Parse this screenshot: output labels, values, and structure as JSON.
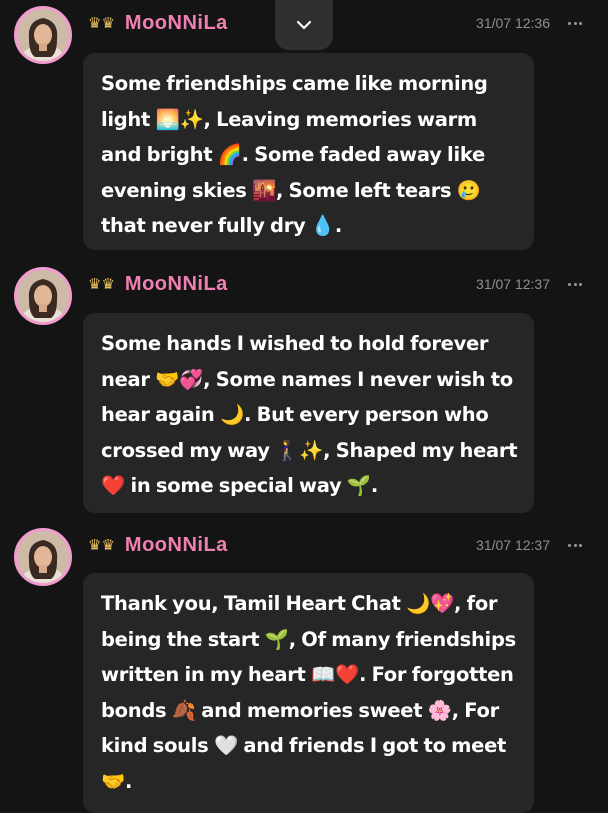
{
  "messages": [
    {
      "username": "MooNNiLa",
      "timestamp": "31/07 12:36",
      "text": "Some friendships came like morning light 🌅✨, Leaving memories warm and bright 🌈. Some faded away like evening skies 🌇, Some left tears 🥲 that never fully dry 💧."
    },
    {
      "username": "MooNNiLa",
      "timestamp": "31/07 12:37",
      "text": "Some hands I wished to hold forever near 🤝💞, Some names I never wish to hear again 🌙. But every person who crossed my way 🚶‍♀️✨, Shaped my heart ❤️ in some special way 🌱."
    },
    {
      "username": "MooNNiLa",
      "timestamp": "31/07 12:37",
      "text": "Thank you, Tamil Heart Chat 🌙💖, for being the start 🌱, Of many friendships written in my heart 📖❤️. For forgotten bonds 🍂 and memories sweet 🌸, For kind souls 🤍 and friends I got to meet 🤝."
    }
  ],
  "icons": {
    "crown": "crown-icon",
    "scroll": "chevron-down-icon",
    "more": "more-options-icon"
  },
  "colors": {
    "background": "#141414",
    "bubble": "#262626",
    "username": "#f07fb2",
    "avatar_border": "#f29bd0",
    "timestamp": "#8e8e8e"
  }
}
